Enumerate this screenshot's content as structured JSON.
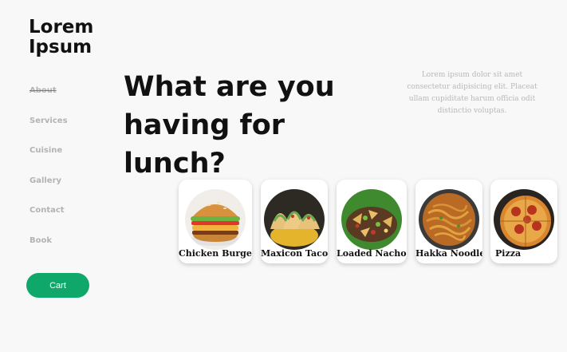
{
  "brand": {
    "line1": "Lorem",
    "line2": "Ipsum"
  },
  "nav": {
    "items": [
      {
        "label": "About"
      },
      {
        "label": "Services"
      },
      {
        "label": "Cuisine"
      },
      {
        "label": "Gallery"
      },
      {
        "label": "Contact"
      },
      {
        "label": "Book"
      }
    ],
    "active": "About"
  },
  "cart": {
    "label": "Cart"
  },
  "hero": {
    "line1": "What are you",
    "line2": "having for lunch?",
    "blurb": "Lorem ipsum dolor sit amet consectetur adipisicing elit. Placeat ullam cupiditate harum officia odit distinctio voluptas."
  },
  "menu": {
    "items": [
      {
        "name": "Chicken Burger",
        "image": "burger-image"
      },
      {
        "name": "Maxicon Taco",
        "image": "taco-image"
      },
      {
        "name": "Loaded Nachos",
        "image": "nachos-image"
      },
      {
        "name": "Hakka Noodle",
        "image": "noodle-image"
      },
      {
        "name": "Pizza",
        "image": "pizza-image"
      }
    ]
  },
  "colors": {
    "accent": "#0fa86a",
    "active_strike": "#d9534f",
    "muted": "#b3b3b3"
  }
}
